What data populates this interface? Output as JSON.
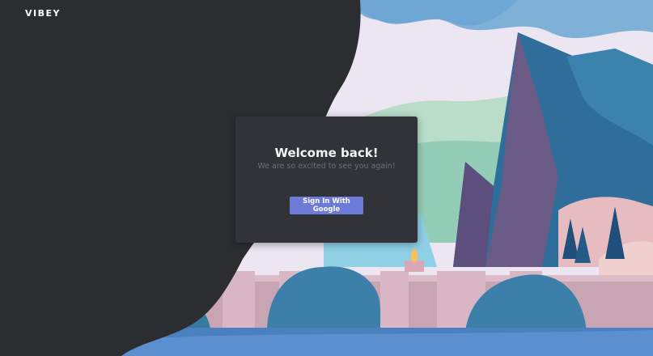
{
  "brand": {
    "logo_text": "VIBEY"
  },
  "login_card": {
    "title": "Welcome back!",
    "subtitle": "We are so excited to see you again!",
    "google_button_label": "Sign In With Google"
  },
  "colors": {
    "dark_panel": "#2b2d31",
    "card_background": "#313338",
    "button": "#6d7ad8",
    "sky": "#efeaf6",
    "mountain": "#2f6e9a",
    "foliage": "#3c7fa8",
    "wall": "#c9a5b4"
  }
}
